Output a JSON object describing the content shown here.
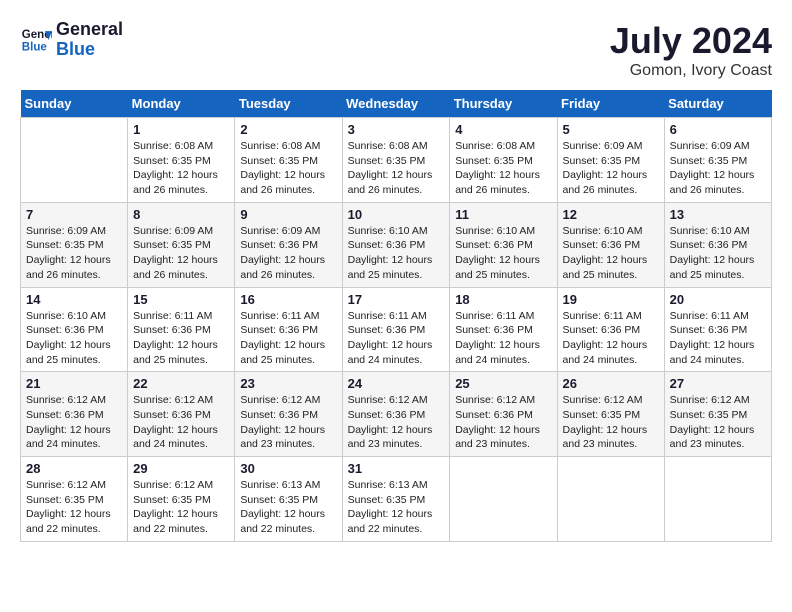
{
  "header": {
    "logo_line1": "General",
    "logo_line2": "Blue",
    "month_year": "July 2024",
    "location": "Gomon, Ivory Coast"
  },
  "days_of_week": [
    "Sunday",
    "Monday",
    "Tuesday",
    "Wednesday",
    "Thursday",
    "Friday",
    "Saturday"
  ],
  "weeks": [
    [
      {
        "day": "",
        "info": ""
      },
      {
        "day": "1",
        "info": "Sunrise: 6:08 AM\nSunset: 6:35 PM\nDaylight: 12 hours\nand 26 minutes."
      },
      {
        "day": "2",
        "info": "Sunrise: 6:08 AM\nSunset: 6:35 PM\nDaylight: 12 hours\nand 26 minutes."
      },
      {
        "day": "3",
        "info": "Sunrise: 6:08 AM\nSunset: 6:35 PM\nDaylight: 12 hours\nand 26 minutes."
      },
      {
        "day": "4",
        "info": "Sunrise: 6:08 AM\nSunset: 6:35 PM\nDaylight: 12 hours\nand 26 minutes."
      },
      {
        "day": "5",
        "info": "Sunrise: 6:09 AM\nSunset: 6:35 PM\nDaylight: 12 hours\nand 26 minutes."
      },
      {
        "day": "6",
        "info": "Sunrise: 6:09 AM\nSunset: 6:35 PM\nDaylight: 12 hours\nand 26 minutes."
      }
    ],
    [
      {
        "day": "7",
        "info": "Sunrise: 6:09 AM\nSunset: 6:35 PM\nDaylight: 12 hours\nand 26 minutes."
      },
      {
        "day": "8",
        "info": "Sunrise: 6:09 AM\nSunset: 6:35 PM\nDaylight: 12 hours\nand 26 minutes."
      },
      {
        "day": "9",
        "info": "Sunrise: 6:09 AM\nSunset: 6:36 PM\nDaylight: 12 hours\nand 26 minutes."
      },
      {
        "day": "10",
        "info": "Sunrise: 6:10 AM\nSunset: 6:36 PM\nDaylight: 12 hours\nand 25 minutes."
      },
      {
        "day": "11",
        "info": "Sunrise: 6:10 AM\nSunset: 6:36 PM\nDaylight: 12 hours\nand 25 minutes."
      },
      {
        "day": "12",
        "info": "Sunrise: 6:10 AM\nSunset: 6:36 PM\nDaylight: 12 hours\nand 25 minutes."
      },
      {
        "day": "13",
        "info": "Sunrise: 6:10 AM\nSunset: 6:36 PM\nDaylight: 12 hours\nand 25 minutes."
      }
    ],
    [
      {
        "day": "14",
        "info": "Sunrise: 6:10 AM\nSunset: 6:36 PM\nDaylight: 12 hours\nand 25 minutes."
      },
      {
        "day": "15",
        "info": "Sunrise: 6:11 AM\nSunset: 6:36 PM\nDaylight: 12 hours\nand 25 minutes."
      },
      {
        "day": "16",
        "info": "Sunrise: 6:11 AM\nSunset: 6:36 PM\nDaylight: 12 hours\nand 25 minutes."
      },
      {
        "day": "17",
        "info": "Sunrise: 6:11 AM\nSunset: 6:36 PM\nDaylight: 12 hours\nand 24 minutes."
      },
      {
        "day": "18",
        "info": "Sunrise: 6:11 AM\nSunset: 6:36 PM\nDaylight: 12 hours\nand 24 minutes."
      },
      {
        "day": "19",
        "info": "Sunrise: 6:11 AM\nSunset: 6:36 PM\nDaylight: 12 hours\nand 24 minutes."
      },
      {
        "day": "20",
        "info": "Sunrise: 6:11 AM\nSunset: 6:36 PM\nDaylight: 12 hours\nand 24 minutes."
      }
    ],
    [
      {
        "day": "21",
        "info": "Sunrise: 6:12 AM\nSunset: 6:36 PM\nDaylight: 12 hours\nand 24 minutes."
      },
      {
        "day": "22",
        "info": "Sunrise: 6:12 AM\nSunset: 6:36 PM\nDaylight: 12 hours\nand 24 minutes."
      },
      {
        "day": "23",
        "info": "Sunrise: 6:12 AM\nSunset: 6:36 PM\nDaylight: 12 hours\nand 23 minutes."
      },
      {
        "day": "24",
        "info": "Sunrise: 6:12 AM\nSunset: 6:36 PM\nDaylight: 12 hours\nand 23 minutes."
      },
      {
        "day": "25",
        "info": "Sunrise: 6:12 AM\nSunset: 6:36 PM\nDaylight: 12 hours\nand 23 minutes."
      },
      {
        "day": "26",
        "info": "Sunrise: 6:12 AM\nSunset: 6:35 PM\nDaylight: 12 hours\nand 23 minutes."
      },
      {
        "day": "27",
        "info": "Sunrise: 6:12 AM\nSunset: 6:35 PM\nDaylight: 12 hours\nand 23 minutes."
      }
    ],
    [
      {
        "day": "28",
        "info": "Sunrise: 6:12 AM\nSunset: 6:35 PM\nDaylight: 12 hours\nand 22 minutes."
      },
      {
        "day": "29",
        "info": "Sunrise: 6:12 AM\nSunset: 6:35 PM\nDaylight: 12 hours\nand 22 minutes."
      },
      {
        "day": "30",
        "info": "Sunrise: 6:13 AM\nSunset: 6:35 PM\nDaylight: 12 hours\nand 22 minutes."
      },
      {
        "day": "31",
        "info": "Sunrise: 6:13 AM\nSunset: 6:35 PM\nDaylight: 12 hours\nand 22 minutes."
      },
      {
        "day": "",
        "info": ""
      },
      {
        "day": "",
        "info": ""
      },
      {
        "day": "",
        "info": ""
      }
    ]
  ]
}
